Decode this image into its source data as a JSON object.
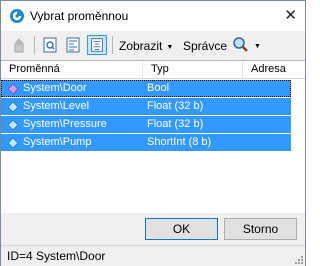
{
  "window": {
    "title": "Vybrat proměnnou",
    "close_glyph": "✕"
  },
  "toolbar": {
    "buttons": [
      {
        "icon": "arrow-up-icon",
        "enabled": false
      },
      {
        "icon": "page-search-icon"
      },
      {
        "icon": "align-left-icon"
      },
      {
        "icon": "align-center-icon",
        "pressed": true
      }
    ],
    "display_label": "Zobrazit",
    "manager_label": "Správce",
    "arrow": "▼"
  },
  "list": {
    "columns": [
      "Proměnná",
      "Typ",
      "Adresa"
    ],
    "rows": [
      {
        "name": "System\\Door",
        "type": "Bool",
        "address": "",
        "icon": "diamond-purple-icon"
      },
      {
        "name": "System\\Level",
        "type": "Float (32 b)",
        "address": "",
        "icon": "diamond-blue-icon"
      },
      {
        "name": "System\\Pressure",
        "type": "Float (32 b)",
        "address": "",
        "icon": "diamond-blue-icon"
      },
      {
        "name": "System\\Pump",
        "type": "ShortInt (8 b)",
        "address": "",
        "icon": "diamond-blue-icon"
      }
    ]
  },
  "buttons": {
    "ok": "OK",
    "cancel": "Storno"
  },
  "status": {
    "text": "ID=4   System\\Door"
  },
  "colors": {
    "selection": "#3399ff",
    "accent": "#0078d7"
  }
}
